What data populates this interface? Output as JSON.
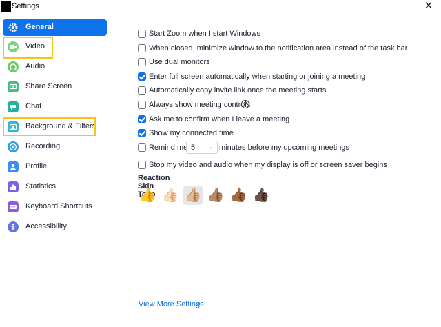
{
  "window": {
    "title": "Settings",
    "close_glyph": "✕"
  },
  "sidebar": {
    "items": [
      {
        "label": "General",
        "icon": "gear-icon",
        "color": "#0e72ed"
      },
      {
        "label": "Video",
        "icon": "video-camera-icon",
        "color": "#7fd37a"
      },
      {
        "label": "Audio",
        "icon": "headphones-icon",
        "color": "#6acb6a"
      },
      {
        "label": "Share Screen",
        "icon": "share-screen-icon",
        "color": "#3fbf86"
      },
      {
        "label": "Chat",
        "icon": "chat-bubble-icon",
        "color": "#25b1a0"
      },
      {
        "label": "Background & Filters",
        "icon": "background-icon",
        "color": "#2db6d3"
      },
      {
        "label": "Recording",
        "icon": "record-icon",
        "color": "#2d9ee6"
      },
      {
        "label": "Profile",
        "icon": "person-icon",
        "color": "#3d8df0"
      },
      {
        "label": "Statistics",
        "icon": "bar-chart-icon",
        "color": "#7d62e8"
      },
      {
        "label": "Keyboard Shortcuts",
        "icon": "keyboard-icon",
        "color": "#8c5fe0"
      },
      {
        "label": "Accessibility",
        "icon": "accessibility-icon",
        "color": "#6574d8"
      }
    ],
    "active_index": 0,
    "highlight_color": "#f5c518"
  },
  "general": {
    "options": [
      {
        "label": "Start Zoom when I start Windows",
        "checked": false
      },
      {
        "label": "When closed, minimize window to the notification area instead of the task bar",
        "checked": false
      },
      {
        "label": "Use dual monitors",
        "checked": false
      },
      {
        "label": "Enter full screen automatically when starting or joining a meeting",
        "checked": true
      },
      {
        "label": "Automatically copy invite link once the meeting starts",
        "checked": false
      },
      {
        "label": "Always show meeting controls",
        "checked": false
      },
      {
        "label": "Ask me to confirm when I leave a meeting",
        "checked": true
      },
      {
        "label": "Show my connected time",
        "checked": true
      }
    ],
    "remind": {
      "prefix": "Remind me",
      "value": "5",
      "suffix": "minutes before my upcoming meetings",
      "checked": false
    },
    "stop_video": {
      "label": "Stop my video and audio when my display is off or screen saver begins",
      "checked": false
    },
    "help_glyph": "?",
    "reaction_title": "Reaction Skin Tone",
    "skin_tones": [
      "👍",
      "👍🏻",
      "👍🏼",
      "👍🏽",
      "👍🏾",
      "👍🏿"
    ],
    "selected_tone": 2,
    "view_more": "View More Settings",
    "external_glyph": "↗"
  }
}
